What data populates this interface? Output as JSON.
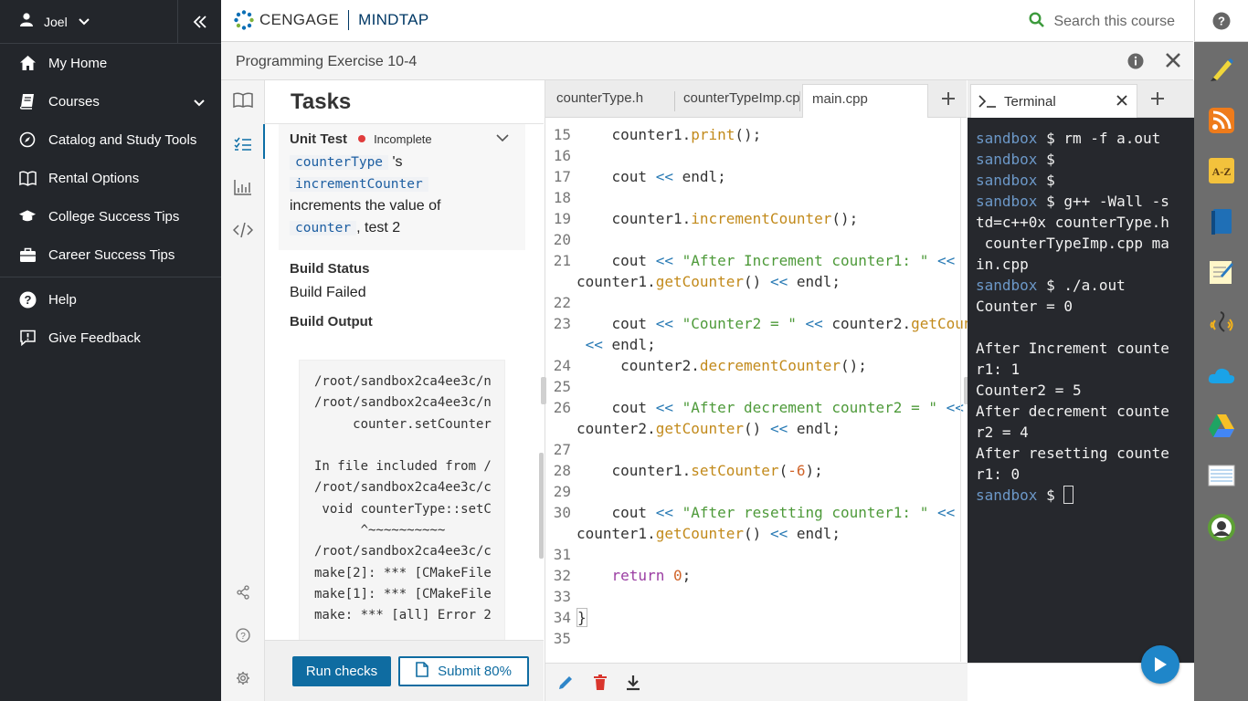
{
  "user": {
    "name": "Joel"
  },
  "nav": {
    "items": [
      {
        "label": "My Home",
        "icon": "home-icon"
      },
      {
        "label": "Courses",
        "icon": "courses-icon",
        "expandable": true
      },
      {
        "label": "Catalog and Study Tools",
        "icon": "compass-icon"
      },
      {
        "label": "Rental Options",
        "icon": "book-open-icon"
      },
      {
        "label": "College Success Tips",
        "icon": "graduation-cap-icon"
      },
      {
        "label": "Career Success Tips",
        "icon": "briefcase-icon"
      },
      {
        "label": "Help",
        "icon": "help-icon"
      },
      {
        "label": "Give Feedback",
        "icon": "feedback-icon"
      }
    ]
  },
  "header": {
    "brand1": "CENGAGE",
    "brand2": "MINDTAP",
    "search_placeholder": "Search this course"
  },
  "titlebar": {
    "title": "Programming Exercise 10-4"
  },
  "tasks": {
    "heading": "Tasks",
    "unit_test": {
      "title": "Unit Test",
      "status": "Incomplete",
      "status_color": "#e03c3c",
      "token1": "counterType",
      "text1": "'s",
      "token2": "incrementCounter",
      "text2": "increments the value of",
      "token3": "counter",
      "text3": ", test 2"
    },
    "build_status_label": "Build Status",
    "build_status_value": "Build Failed",
    "build_output_label": "Build Output",
    "build_output": "/root/sandbox2ca4ee3c/n\n/root/sandbox2ca4ee3c/n\n     counter.setCounter\n\nIn file included from /\n/root/sandbox2ca4ee3c/c\n void counterType::setC\n      ^~~~~~~~~~~\n/root/sandbox2ca4ee3c/c\nmake[2]: *** [CMakeFile\nmake[1]: *** [CMakeFile\nmake: *** [all] Error 2",
    "run_checks": "Run checks",
    "submit": "Submit 80%"
  },
  "editor": {
    "tabs": [
      "counterType.h",
      "counterTypeImp.cpp",
      "main.cpp"
    ],
    "active_tab": "main.cpp"
  },
  "terminal": {
    "tab_label": "Terminal",
    "prompt_user": "sandbox",
    "lines": [
      {
        "prompt": true,
        "text": " $ rm -f a.out"
      },
      {
        "prompt": true,
        "text": " $"
      },
      {
        "prompt": true,
        "text": " $"
      },
      {
        "prompt": true,
        "text": " $ g++ -Wall -s"
      },
      {
        "prompt": false,
        "text": "td=c++0x counterType.h"
      },
      {
        "prompt": false,
        "text": " counterTypeImp.cpp ma"
      },
      {
        "prompt": false,
        "text": "in.cpp"
      },
      {
        "prompt": true,
        "text": " $ ./a.out"
      },
      {
        "prompt": false,
        "text": "Counter = 0"
      },
      {
        "prompt": false,
        "text": ""
      },
      {
        "prompt": false,
        "text": "After Increment counte"
      },
      {
        "prompt": false,
        "text": "r1: 1"
      },
      {
        "prompt": false,
        "text": "Counter2 = 5"
      },
      {
        "prompt": false,
        "text": "After decrement counte"
      },
      {
        "prompt": false,
        "text": "r2 = 4"
      },
      {
        "prompt": false,
        "text": "After resetting counte"
      },
      {
        "prompt": false,
        "text": "r1: 0"
      },
      {
        "prompt": true,
        "text": " $ "
      }
    ]
  },
  "colors": {
    "nav_bg": "#23262b",
    "accent": "#0f6ca1",
    "terminal_bg": "#26282d"
  }
}
